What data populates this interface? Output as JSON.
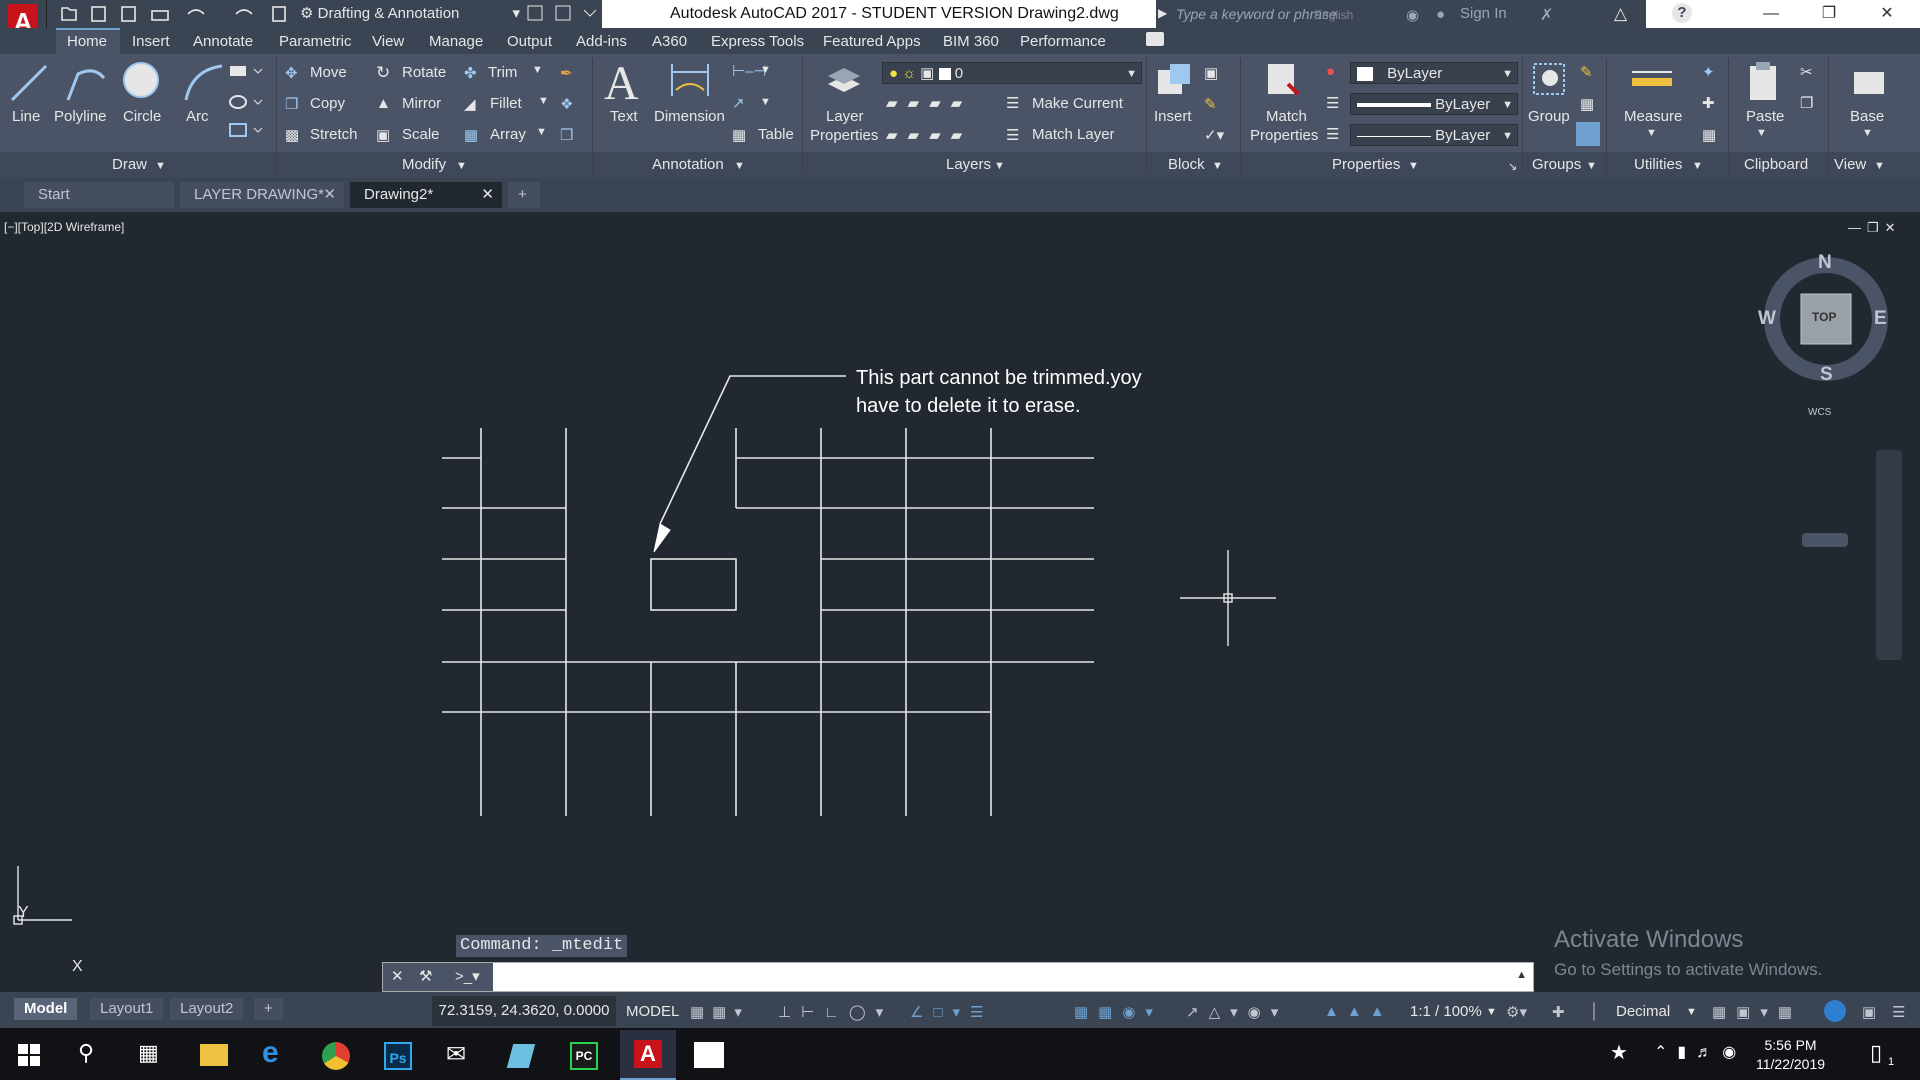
{
  "titlebar": {
    "workspace": "Drafting & Annotation",
    "title": "Autodesk AutoCAD 2017 - STUDENT VERSION    Drawing2.dwg",
    "search_placeholder": "Type a keyword or phrase",
    "search_lang": "English",
    "sign_in": "Sign In"
  },
  "menu": [
    "Home",
    "Insert",
    "Annotate",
    "Parametric",
    "View",
    "Manage",
    "Output",
    "Add-ins",
    "A360",
    "Express Tools",
    "Featured Apps",
    "BIM 360",
    "Performance"
  ],
  "ribbon": {
    "draw": {
      "line": "Line",
      "polyline": "Polyline",
      "circle": "Circle",
      "arc": "Arc",
      "label": "Draw"
    },
    "modify": {
      "move": "Move",
      "rotate": "Rotate",
      "trim": "Trim",
      "copy": "Copy",
      "mirror": "Mirror",
      "fillet": "Fillet",
      "stretch": "Stretch",
      "scale": "Scale",
      "array": "Array",
      "label": "Modify"
    },
    "annotation": {
      "text": "Text",
      "dimension": "Dimension",
      "table": "Table",
      "label": "Annotation"
    },
    "layers": {
      "layer_properties_1": "Layer",
      "layer_properties_2": "Properties",
      "current_layer": "0",
      "make_current": "Make Current",
      "match_layer": "Match Layer",
      "label": "Layers"
    },
    "block": {
      "insert": "Insert",
      "label": "Block"
    },
    "properties": {
      "match_1": "Match",
      "match_2": "Properties",
      "color": "ByLayer",
      "lineweight": "ByLayer",
      "linetype": "ByLayer",
      "label": "Properties"
    },
    "groups": {
      "group": "Group",
      "label": "Groups"
    },
    "utilities": {
      "measure": "Measure",
      "label": "Utilities"
    },
    "clipboard": {
      "paste": "Paste",
      "label": "Clipboard"
    },
    "view": {
      "base": "Base",
      "label": "View"
    }
  },
  "doc_tabs": [
    "Start",
    "LAYER DRAWING*",
    "Drawing2*"
  ],
  "viewport": {
    "label": "[−][Top][2D Wireframe]",
    "annotation_line1": "This part cannot be trimmed.yoy",
    "annotation_line2": "have to delete it to erase.",
    "viewcube": {
      "n": "N",
      "s": "S",
      "e": "E",
      "w": "W",
      "top": "TOP",
      "wcs": "WCS"
    },
    "ucs": {
      "x": "X",
      "y": "Y"
    }
  },
  "command": {
    "history": "Command:  _mtedit",
    "prompt_value": ""
  },
  "watermark": {
    "title": "Activate Windows",
    "subtitle": "Go to Settings to activate Windows."
  },
  "status": {
    "layouts": [
      "Model",
      "Layout1",
      "Layout2"
    ],
    "coords": "72.3159, 24.3620, 0.0000",
    "space": "MODEL",
    "scale": "1:1 / 100%",
    "units": "Decimal"
  },
  "taskbar": {
    "time": "5:56 PM",
    "date": "11/22/2019",
    "notification_count": "1"
  },
  "colors": {
    "canvas": "#212830",
    "ribbon": "#4a5466",
    "autocad_red": "#c7141a"
  }
}
